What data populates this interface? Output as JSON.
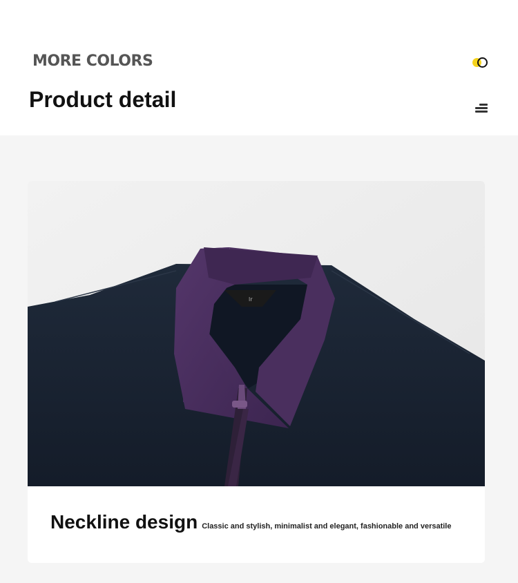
{
  "header": {
    "more_colors": "MORE COLORS",
    "title": "Product detail",
    "color_toggle_icon": "color-swatch-toggle",
    "menu_icon": "menu-list",
    "accent_yellow": "#f5d31c"
  },
  "product": {
    "image_subject": "navy shirt with purple zip collar",
    "shirt_color": "#1b2534",
    "collar_color": "#4a2f5c",
    "caption_title": "Neckline design",
    "caption_desc": "Classic and stylish, minimalist and elegant, fashionable and versatile"
  }
}
